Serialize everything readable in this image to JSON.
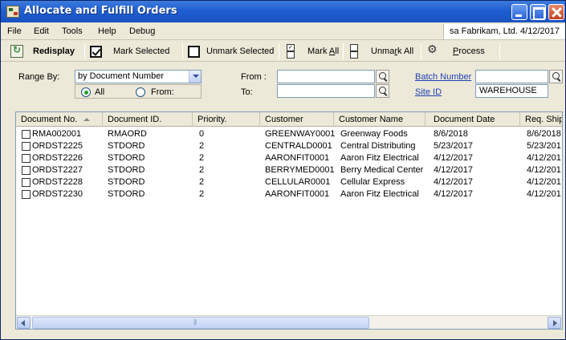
{
  "window": {
    "title": "Allocate and Fulfill Orders"
  },
  "menu": {
    "items": [
      "File",
      "Edit",
      "Tools",
      "Help",
      "Debug"
    ],
    "status": "sa  Fabrikam, Ltd.  4/12/2017"
  },
  "toolbar": {
    "redisplay": "Redisplay",
    "mark_selected": "Mark Selected",
    "unmark_selected": "Unmark Selected",
    "mark_all_prefix": "Mark ",
    "mark_all_key": "A",
    "mark_all_suffix": "ll",
    "unmark_all_prefix": "Unma",
    "unmark_all_key": "r",
    "unmark_all_suffix": "k All",
    "process_key": "P",
    "process_suffix": "rocess"
  },
  "range": {
    "label": "Range By:",
    "selected": "by Document Number",
    "all_label": "All",
    "from_label": "From:",
    "from_field_label": "From :",
    "to_field_label": "To:",
    "from_value": "",
    "to_value": ""
  },
  "batch": {
    "batch_label": "Batch Number",
    "batch_value": "",
    "site_label": "Site ID",
    "site_value": "WAREHOUSE"
  },
  "grid": {
    "columns": [
      "Document No.",
      "Document ID.",
      "Priority.",
      "Customer",
      "Customer Name",
      "Document Date",
      "Req. Ship"
    ],
    "rows": [
      [
        "RMA002001",
        "RMAORD",
        "0",
        "GREENWAY0001",
        "Greenway Foods",
        "8/6/2018",
        "8/6/2018"
      ],
      [
        "ORDST2225",
        "STDORD",
        "2",
        "CENTRALD0001",
        "Central Distributing",
        "5/23/2017",
        "5/23/201"
      ],
      [
        "ORDST2226",
        "STDORD",
        "2",
        "AARONFIT0001",
        "Aaron Fitz Electrical",
        "4/12/2017",
        "4/12/201"
      ],
      [
        "ORDST2227",
        "STDORD",
        "2",
        "BERRYMED0001",
        "Berry Medical Center",
        "4/12/2017",
        "4/12/201"
      ],
      [
        "ORDST2228",
        "STDORD",
        "2",
        "CELLULAR0001",
        "Cellular Express",
        "4/12/2017",
        "4/12/201"
      ],
      [
        "ORDST2230",
        "STDORD",
        "2",
        "AARONFIT0001",
        "Aaron Fitz Electrical",
        "4/12/2017",
        "4/12/201"
      ]
    ]
  }
}
